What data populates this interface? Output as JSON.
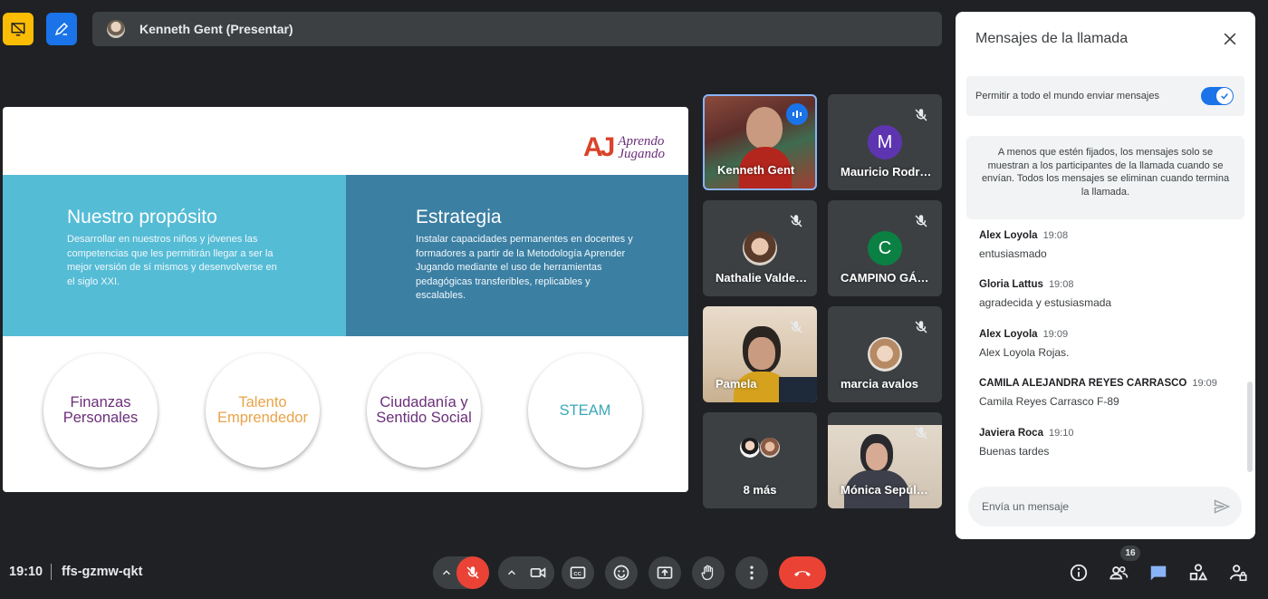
{
  "header": {
    "presenter_label": "Kenneth Gent (Presentar)"
  },
  "slide": {
    "logo_mark": "AJ",
    "logo_line1": "Aprendo",
    "logo_line2": "Jugando",
    "left_title": "Nuestro propósito",
    "left_text": "Desarrollar en nuestros niños y jóvenes las competencias que les permitirán llegar a ser la mejor versión de sí mismos y desenvolverse en el siglo XXI.",
    "right_title": "Estrategia",
    "right_text": "Instalar capacidades permanentes en docentes y formadores a partir de la Metodología Aprender Jugando mediante el uso de herramientas pedagógicas transferibles, replicables y escalables.",
    "circles": [
      {
        "line1": "Finanzas",
        "line2": "Personales",
        "color": "#6b2f7a"
      },
      {
        "line1": "Talento",
        "line2": "Emprendedor",
        "color": "#e8a34a"
      },
      {
        "line1": "Ciudadanía y",
        "line2": "Sentido Social",
        "color": "#6b2f7a"
      },
      {
        "line1": "STEAM",
        "line2": "",
        "color": "#3aa7b8"
      }
    ]
  },
  "participants": [
    {
      "name": "Kenneth Gent"
    },
    {
      "name": "Mauricio Rodr…",
      "initial": "M",
      "color": "#5e35b1"
    },
    {
      "name": "Nathalie Valde…"
    },
    {
      "name": "CAMPINO GÁ…",
      "initial": "C",
      "color": "#0b8043"
    },
    {
      "name": "Pamela"
    },
    {
      "name": "marcia avalos"
    },
    {
      "name": "8 más"
    },
    {
      "name": "Mónica Sepúl…"
    }
  ],
  "chat": {
    "title": "Mensajes de la llamada",
    "permit_label": "Permitir a todo el mundo enviar mensajes",
    "info": "A menos que estén fijados, los mensajes solo se muestran a los participantes de la llamada cuando se envían. Todos los mensajes se eliminan cuando termina la llamada.",
    "messages": [
      {
        "sender": "Alex Loyola",
        "time": "19:08",
        "text": "entusiasmado"
      },
      {
        "sender": "Gloria Lattus",
        "time": "19:08",
        "text": "agradecida y estusiasmada"
      },
      {
        "sender": "Alex Loyola",
        "time": "19:09",
        "text": "Alex Loyola Rojas."
      },
      {
        "sender": "CAMILA ALEJANDRA REYES CARRASCO",
        "time": "19:09",
        "text": "Camila Reyes Carrasco F-89"
      },
      {
        "sender": "Javiera Roca",
        "time": "19:10",
        "text": "Buenas tardes"
      }
    ],
    "input_placeholder": "Envía un mensaje"
  },
  "footer": {
    "time": "19:10",
    "meeting_code": "ffs-gzmw-qkt",
    "participant_count": "16"
  },
  "colors": {
    "accent": "#1a73e8",
    "mic_off": "#ea4335",
    "leave": "#ea4335",
    "chat_active": "#8ab4f8"
  }
}
